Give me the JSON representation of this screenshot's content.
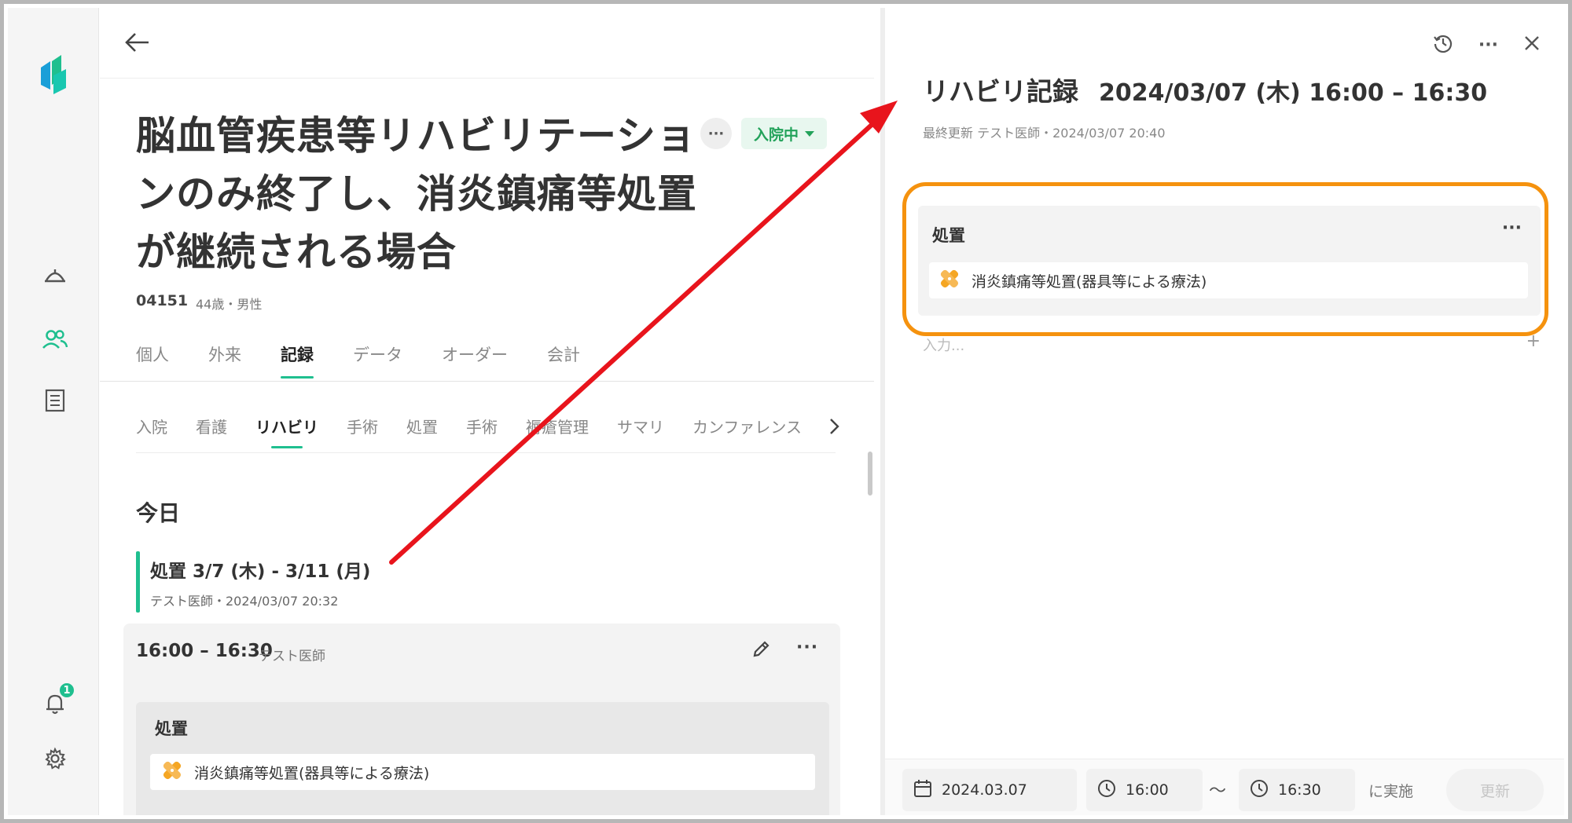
{
  "patient": {
    "title": "脳血管疾患等リハビリテーションのみ終了し、消炎鎮痛等処置が継続される場合",
    "id": "04151",
    "info": "44歳・男性",
    "status": "入院中"
  },
  "sidebar": {
    "notification_count": "1"
  },
  "tabs": [
    {
      "label": "個人"
    },
    {
      "label": "外来"
    },
    {
      "label": "記録"
    },
    {
      "label": "データ"
    },
    {
      "label": "オーダー"
    },
    {
      "label": "会計"
    }
  ],
  "subtabs": [
    {
      "label": "入院"
    },
    {
      "label": "看護"
    },
    {
      "label": "リハビリ"
    },
    {
      "label": "手術"
    },
    {
      "label": "処置"
    },
    {
      "label": "手術"
    },
    {
      "label": "褥瘡管理"
    },
    {
      "label": "サマリ"
    },
    {
      "label": "カンファレンス"
    }
  ],
  "left": {
    "today_label": "今日",
    "record": {
      "title": "処置 3/7 (木) - 3/11 (月)",
      "meta": "テスト医師・2024/03/07 20:32"
    },
    "card": {
      "time": "16:00 – 16:30",
      "doctor": "テスト医師",
      "section_title": "処置",
      "item": "消炎鎮痛等処置(器具等による療法)"
    }
  },
  "right": {
    "title": "リハビリ記録",
    "date": "2024/03/07 (木) 16:00 – 16:30",
    "meta": "最終更新 テスト医師・2024/03/07 20:40",
    "section_title": "処置",
    "item": "消炎鎮痛等処置(器具等による療法)",
    "placeholder": "入力...",
    "footer": {
      "date": "2024.03.07",
      "start": "16:00",
      "tilde": "～",
      "end": "16:30",
      "suffix": "に実施",
      "update_label": "更新"
    }
  },
  "colors": {
    "accent": "#1fbf8f",
    "highlight": "#f5920e",
    "arrow": "#e8141c"
  }
}
